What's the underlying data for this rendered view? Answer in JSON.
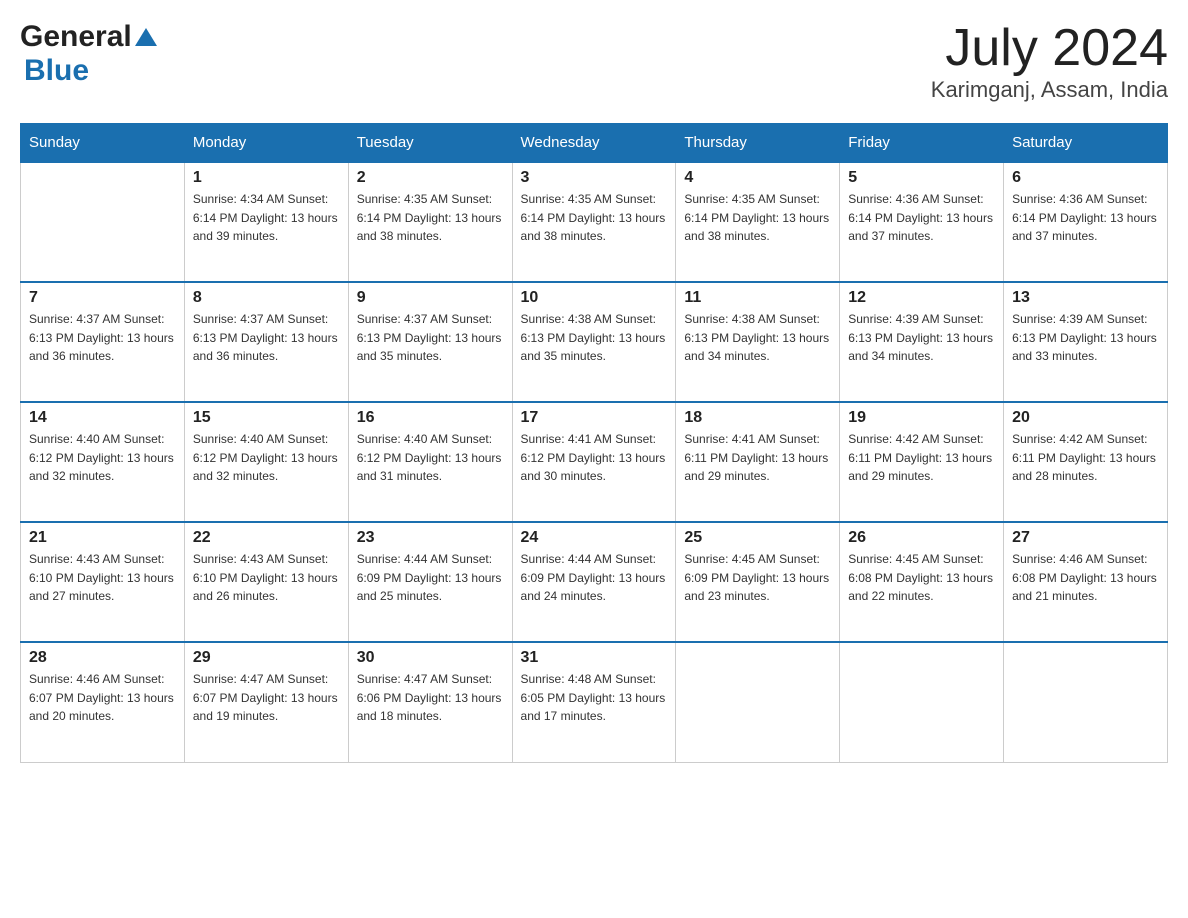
{
  "header": {
    "title": "July 2024",
    "subtitle": "Karimganj, Assam, India",
    "logo_general": "General",
    "logo_blue": "Blue"
  },
  "days_of_week": [
    "Sunday",
    "Monday",
    "Tuesday",
    "Wednesday",
    "Thursday",
    "Friday",
    "Saturday"
  ],
  "weeks": [
    [
      {
        "num": "",
        "detail": ""
      },
      {
        "num": "1",
        "detail": "Sunrise: 4:34 AM\nSunset: 6:14 PM\nDaylight: 13 hours\nand 39 minutes."
      },
      {
        "num": "2",
        "detail": "Sunrise: 4:35 AM\nSunset: 6:14 PM\nDaylight: 13 hours\nand 38 minutes."
      },
      {
        "num": "3",
        "detail": "Sunrise: 4:35 AM\nSunset: 6:14 PM\nDaylight: 13 hours\nand 38 minutes."
      },
      {
        "num": "4",
        "detail": "Sunrise: 4:35 AM\nSunset: 6:14 PM\nDaylight: 13 hours\nand 38 minutes."
      },
      {
        "num": "5",
        "detail": "Sunrise: 4:36 AM\nSunset: 6:14 PM\nDaylight: 13 hours\nand 37 minutes."
      },
      {
        "num": "6",
        "detail": "Sunrise: 4:36 AM\nSunset: 6:14 PM\nDaylight: 13 hours\nand 37 minutes."
      }
    ],
    [
      {
        "num": "7",
        "detail": "Sunrise: 4:37 AM\nSunset: 6:13 PM\nDaylight: 13 hours\nand 36 minutes."
      },
      {
        "num": "8",
        "detail": "Sunrise: 4:37 AM\nSunset: 6:13 PM\nDaylight: 13 hours\nand 36 minutes."
      },
      {
        "num": "9",
        "detail": "Sunrise: 4:37 AM\nSunset: 6:13 PM\nDaylight: 13 hours\nand 35 minutes."
      },
      {
        "num": "10",
        "detail": "Sunrise: 4:38 AM\nSunset: 6:13 PM\nDaylight: 13 hours\nand 35 minutes."
      },
      {
        "num": "11",
        "detail": "Sunrise: 4:38 AM\nSunset: 6:13 PM\nDaylight: 13 hours\nand 34 minutes."
      },
      {
        "num": "12",
        "detail": "Sunrise: 4:39 AM\nSunset: 6:13 PM\nDaylight: 13 hours\nand 34 minutes."
      },
      {
        "num": "13",
        "detail": "Sunrise: 4:39 AM\nSunset: 6:13 PM\nDaylight: 13 hours\nand 33 minutes."
      }
    ],
    [
      {
        "num": "14",
        "detail": "Sunrise: 4:40 AM\nSunset: 6:12 PM\nDaylight: 13 hours\nand 32 minutes."
      },
      {
        "num": "15",
        "detail": "Sunrise: 4:40 AM\nSunset: 6:12 PM\nDaylight: 13 hours\nand 32 minutes."
      },
      {
        "num": "16",
        "detail": "Sunrise: 4:40 AM\nSunset: 6:12 PM\nDaylight: 13 hours\nand 31 minutes."
      },
      {
        "num": "17",
        "detail": "Sunrise: 4:41 AM\nSunset: 6:12 PM\nDaylight: 13 hours\nand 30 minutes."
      },
      {
        "num": "18",
        "detail": "Sunrise: 4:41 AM\nSunset: 6:11 PM\nDaylight: 13 hours\nand 29 minutes."
      },
      {
        "num": "19",
        "detail": "Sunrise: 4:42 AM\nSunset: 6:11 PM\nDaylight: 13 hours\nand 29 minutes."
      },
      {
        "num": "20",
        "detail": "Sunrise: 4:42 AM\nSunset: 6:11 PM\nDaylight: 13 hours\nand 28 minutes."
      }
    ],
    [
      {
        "num": "21",
        "detail": "Sunrise: 4:43 AM\nSunset: 6:10 PM\nDaylight: 13 hours\nand 27 minutes."
      },
      {
        "num": "22",
        "detail": "Sunrise: 4:43 AM\nSunset: 6:10 PM\nDaylight: 13 hours\nand 26 minutes."
      },
      {
        "num": "23",
        "detail": "Sunrise: 4:44 AM\nSunset: 6:09 PM\nDaylight: 13 hours\nand 25 minutes."
      },
      {
        "num": "24",
        "detail": "Sunrise: 4:44 AM\nSunset: 6:09 PM\nDaylight: 13 hours\nand 24 minutes."
      },
      {
        "num": "25",
        "detail": "Sunrise: 4:45 AM\nSunset: 6:09 PM\nDaylight: 13 hours\nand 23 minutes."
      },
      {
        "num": "26",
        "detail": "Sunrise: 4:45 AM\nSunset: 6:08 PM\nDaylight: 13 hours\nand 22 minutes."
      },
      {
        "num": "27",
        "detail": "Sunrise: 4:46 AM\nSunset: 6:08 PM\nDaylight: 13 hours\nand 21 minutes."
      }
    ],
    [
      {
        "num": "28",
        "detail": "Sunrise: 4:46 AM\nSunset: 6:07 PM\nDaylight: 13 hours\nand 20 minutes."
      },
      {
        "num": "29",
        "detail": "Sunrise: 4:47 AM\nSunset: 6:07 PM\nDaylight: 13 hours\nand 19 minutes."
      },
      {
        "num": "30",
        "detail": "Sunrise: 4:47 AM\nSunset: 6:06 PM\nDaylight: 13 hours\nand 18 minutes."
      },
      {
        "num": "31",
        "detail": "Sunrise: 4:48 AM\nSunset: 6:05 PM\nDaylight: 13 hours\nand 17 minutes."
      },
      {
        "num": "",
        "detail": ""
      },
      {
        "num": "",
        "detail": ""
      },
      {
        "num": "",
        "detail": ""
      }
    ]
  ]
}
